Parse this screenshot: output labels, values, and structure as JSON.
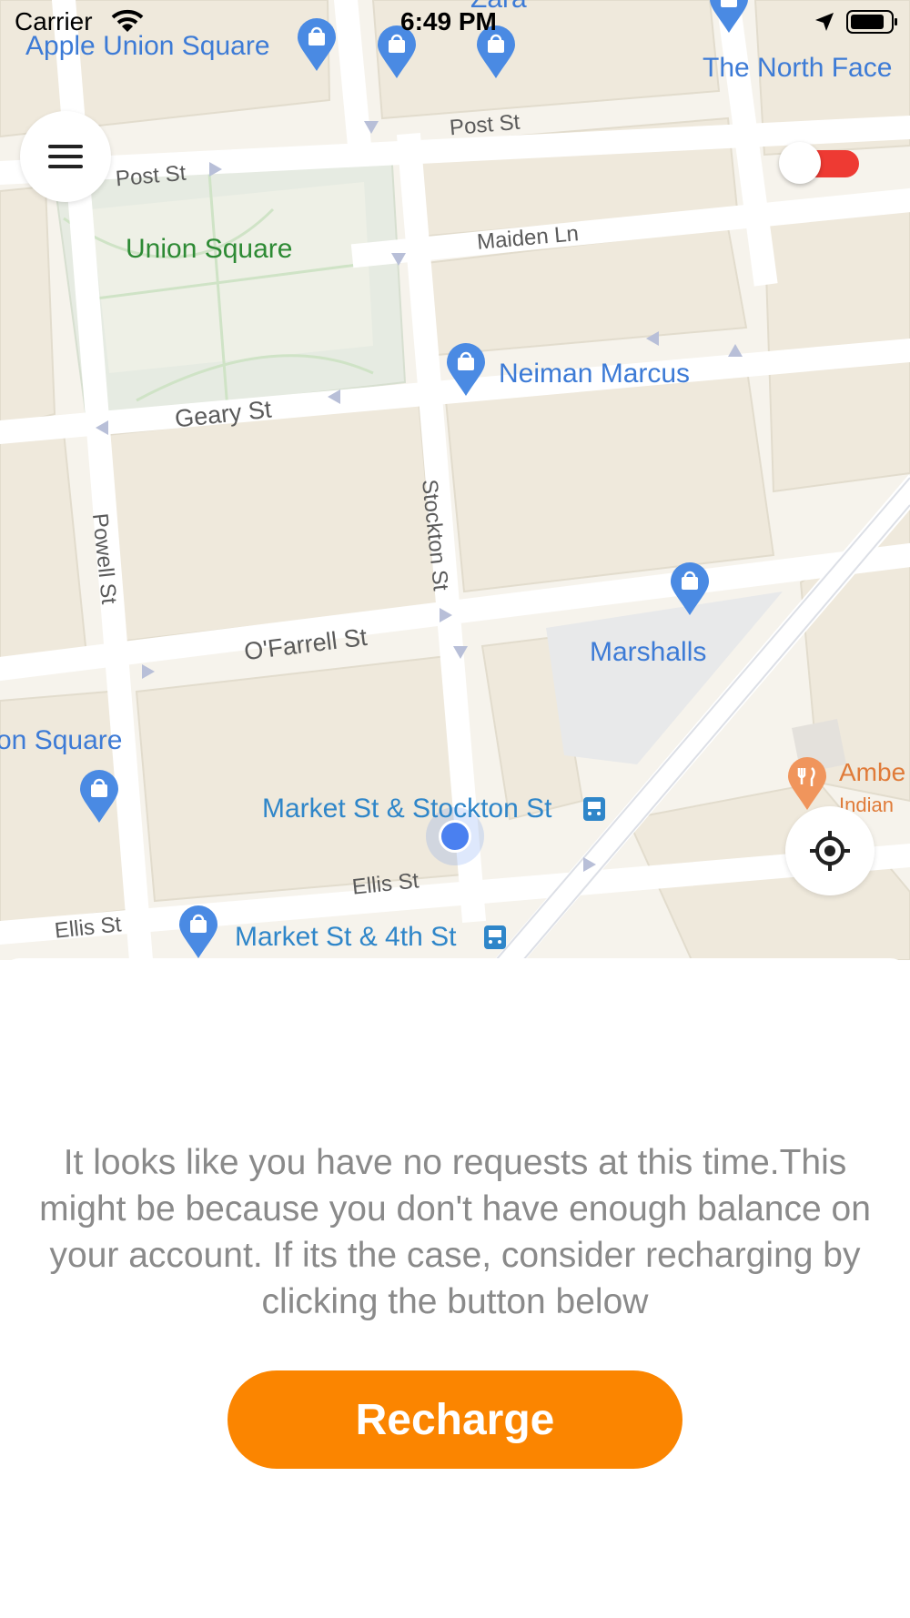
{
  "status_bar": {
    "carrier": "Carrier",
    "time": "6:49 PM",
    "icons": [
      "wifi-icon",
      "location-arrow-icon",
      "battery-icon"
    ]
  },
  "map": {
    "places": {
      "apple_union_square": "Apple Union Square",
      "zara": "Zara",
      "the_north_face": "The North Face",
      "union_square": "Union Square",
      "union_square_partial": "on Square",
      "neiman_marcus": "Neiman Marcus",
      "marshalls": "Marshalls",
      "market_stockton": "Market St & Stockton St",
      "market_4th": "Market St & 4th St",
      "amber": "Ambe",
      "amber_sub": "Indian"
    },
    "streets": {
      "post_st_a": "Post St",
      "post_st_b": "Post St",
      "maiden_ln": "Maiden Ln",
      "geary_st": "Geary St",
      "powell_st": "Powell St",
      "stockton_st": "Stockton St",
      "ofarrell_st": "O'Farrell St",
      "ellis_st_a": "Ellis St",
      "ellis_st_b": "Ellis St"
    }
  },
  "controls": {
    "menu_icon": "hamburger-menu-icon",
    "toggle_on": true,
    "toggle_color": "#ee3a33",
    "locate_icon": "crosshair-locate-icon"
  },
  "sheet": {
    "message": "It looks like you have no requests at this time.This might be because you don't have enough balance on your account. If its the case, consider recharging by clicking the button below",
    "recharge_label": "Recharge",
    "accent": "#fb8500"
  }
}
